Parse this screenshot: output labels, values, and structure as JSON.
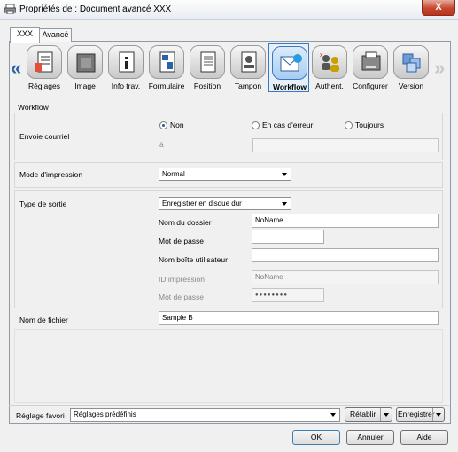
{
  "window": {
    "title": "Propriétés de : Document avancé XXX",
    "close_label": "X"
  },
  "tabs": [
    "XXX",
    "Avancé"
  ],
  "toolbar": {
    "left_arrow": "«",
    "right_arrow": "»",
    "items": [
      {
        "label": "Réglages",
        "icon": "settings-icon"
      },
      {
        "label": "Image",
        "icon": "image-icon"
      },
      {
        "label": "Info trav.",
        "icon": "info-icon"
      },
      {
        "label": "Formulaire",
        "icon": "form-icon"
      },
      {
        "label": "Position",
        "icon": "position-icon"
      },
      {
        "label": "Tampon",
        "icon": "stamp-icon"
      },
      {
        "label": "Workflow",
        "icon": "workflow-icon",
        "selected": true
      },
      {
        "label": "Authent.",
        "icon": "users-icon"
      },
      {
        "label": "Configurer",
        "icon": "printer-icon"
      },
      {
        "label": "Version",
        "icon": "version-icon"
      }
    ]
  },
  "section_title": "Workflow",
  "email": {
    "label": "Envoie courriel",
    "options": [
      "Non",
      "En cas d'erreur",
      "Toujours"
    ],
    "selected": "Non",
    "to_label": "à",
    "to_value": ""
  },
  "print_mode": {
    "label": "Mode d'impression",
    "value": "Normal"
  },
  "output": {
    "label": "Type de sortie",
    "value": "Enregistrer en disque dur",
    "folder_label": "Nom du dossier",
    "folder_value": "NoName",
    "password_label": "Mot de passe",
    "password_value": "",
    "userbox_label": "Nom boîte utilisateur",
    "userbox_value": "",
    "print_id_label": "ID impression",
    "print_id_value": "NoName",
    "print_pw_label": "Mot de passe",
    "print_pw_value": "●●●●●●●●"
  },
  "filename": {
    "label": "Nom de fichier",
    "value": "Sample B"
  },
  "favorites": {
    "label": "Réglage favori",
    "value": "Réglages prédéfinis",
    "restore": "Rétablir",
    "save": "Enregistrer"
  },
  "buttons": {
    "ok": "OK",
    "cancel": "Annuler",
    "help": "Aide"
  }
}
